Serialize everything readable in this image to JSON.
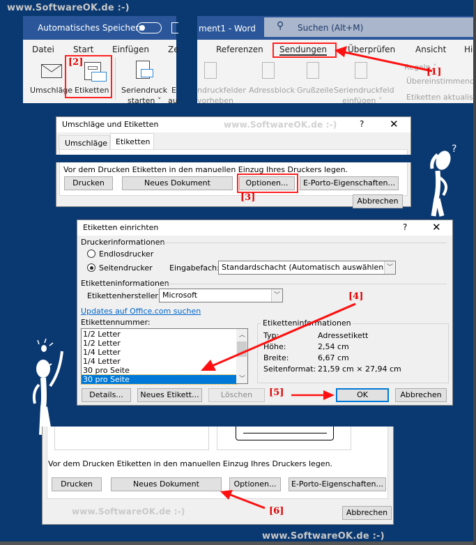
{
  "watermark": {
    "text": "www.SoftwareOK.de :-)"
  },
  "word_window": {
    "autosave_label": "Automatisches Speichern",
    "autosave_state": "off",
    "doc_title": "ment1  -  Word",
    "search_placeholder": "Suchen (Alt+M)",
    "tabs": [
      {
        "label": "Datei"
      },
      {
        "label": "Start"
      },
      {
        "label": "Einfügen"
      },
      {
        "label": "Ze"
      },
      {
        "label": "Referenzen"
      },
      {
        "label": "Sendungen",
        "active": true
      },
      {
        "label": "Überprüfen"
      },
      {
        "label": "Ansicht"
      },
      {
        "label": "Hi"
      }
    ],
    "ribbon_buttons": [
      {
        "label": "Umschläge",
        "icon": "envelope-icon"
      },
      {
        "label": "Etiketten",
        "icon": "labels-icon"
      },
      {
        "label": "Seriendruck",
        "label2": "starten ˅",
        "icon": "mail-merge-icon"
      },
      {
        "label": "E",
        "label2": "au"
      },
      {
        "label": "ndruckfelder",
        "label2": "vorheben",
        "disabled": true
      },
      {
        "label": "Adressblock",
        "disabled": true
      },
      {
        "label": "Grußzeile",
        "disabled": true
      },
      {
        "label": "Seriendruckfeld",
        "label2": "einfügen ˅",
        "disabled": true
      }
    ],
    "ribbon_small": [
      {
        "label": "Regeln ˅"
      },
      {
        "label": "Übereinstimmend"
      },
      {
        "label": "Etiketten aktualisi"
      }
    ]
  },
  "annotations": {
    "step1": "[1]",
    "step2": "[2]",
    "step3": "[3]",
    "step4": "[4]",
    "step5": "[5]",
    "step6": "[6]"
  },
  "envelopes_dialog": {
    "title": "Umschläge und Etiketten",
    "help": "?",
    "close": "✕",
    "tabs": [
      {
        "label": "Umschläge",
        "underline": "U"
      },
      {
        "label": "Etiketten",
        "underline": "E",
        "active": true
      }
    ],
    "note": "Vor dem Drucken Etiketten in den manuellen Einzug Ihres Druckers legen.",
    "buttons": {
      "print": "Drucken",
      "new_document": "Neues Dokument",
      "options": "Optionen...",
      "eporto": "E-Porto-Eigenschaften...",
      "cancel": "Abbrechen"
    }
  },
  "label_setup_dialog": {
    "title": "Etiketten einrichten",
    "help": "?",
    "close": "✕",
    "printer_info_label": "Druckerinformationen",
    "continuous_printer": "Endlosdrucker",
    "page_printer": "Seitendrucker",
    "printer_type_selected": "Seitendrucker",
    "tray_label": "Eingabefach:",
    "tray_value": "Standardschacht (Automatisch auswählen)",
    "label_info_label": "Etiketteninformationen",
    "vendor_label": "Etikettenhersteller:",
    "vendor_value": "Microsoft",
    "updates_link": "Updates auf Office.com suchen",
    "product_number_label": "Etikettennummer:",
    "product_numbers": [
      "1/2 Letter",
      "1/2 Letter",
      "1/4 Letter",
      "1/4 Letter",
      "30 pro Seite",
      "30 pro Seite"
    ],
    "selected_index": 5,
    "info_group_label": "Etiketteninformationen",
    "info": [
      {
        "key": "Typ:",
        "value": "Adressetikett"
      },
      {
        "key": "Höhe:",
        "value": "2,54 cm"
      },
      {
        "key": "Breite:",
        "value": "6,67 cm"
      },
      {
        "key": "Seitenformat:",
        "value": "21,59 cm × 27,94 cm"
      }
    ],
    "buttons": {
      "details": "Details...",
      "new_label": "Neues Etikett...",
      "delete": "Löschen",
      "ok": "OK",
      "cancel": "Abbrechen"
    }
  },
  "envelopes_dialog_bottom": {
    "note": "Vor dem Drucken Etiketten in den manuellen Einzug Ihres Druckers legen.",
    "buttons": {
      "print": "Drucken",
      "new_document": "Neues Dokument",
      "options": "Optionen...",
      "eporto": "E-Porto-Eigenschaften...",
      "cancel": "Abbrechen"
    }
  }
}
